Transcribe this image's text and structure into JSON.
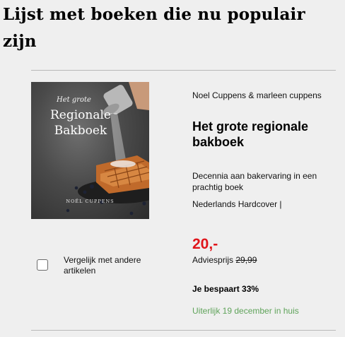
{
  "heading": "Lijst met boeken die nu populair zijn",
  "product": {
    "cover": {
      "subtitle": "Het grote",
      "title_line1": "Regionale",
      "title_line2": "Bakboek",
      "author": "NOËL CUPPENS"
    },
    "author": "Noel Cuppens & marleen cuppens",
    "title": "Het grote regionale bakboek",
    "description": "Decennia aan bakervaring in een prachtig boek",
    "format": "Nederlands Hardcover |",
    "price": "20,-",
    "rrp_label": "Adviesprijs",
    "rrp_value": "29,99",
    "savings": "Je bespaart 33%",
    "delivery": "Uiterlijk 19 december in huis",
    "compare_label": "Vergelijk met andere artikelen"
  },
  "colors": {
    "price": "#e0151b",
    "delivery": "#5fa35a",
    "divider": "#b9b9b9"
  }
}
